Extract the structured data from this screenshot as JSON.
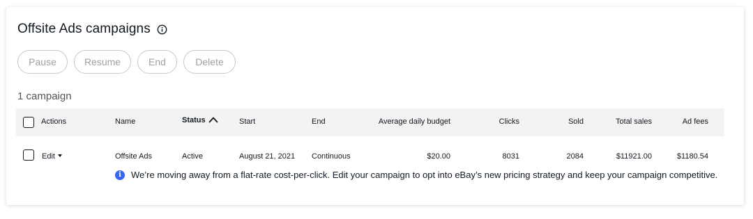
{
  "header": {
    "title": "Offsite Ads campaigns",
    "info_icon": "info-circle-icon"
  },
  "actions": {
    "pause": "Pause",
    "resume": "Resume",
    "end": "End",
    "delete": "Delete"
  },
  "campaign_count": "1 campaign",
  "table": {
    "columns": {
      "actions": "Actions",
      "name": "Name",
      "status": "Status",
      "start": "Start",
      "end": "End",
      "budget": "Average daily budget",
      "clicks": "Clicks",
      "sold": "Sold",
      "total_sales": "Total sales",
      "ad_fees": "Ad fees"
    },
    "sort": {
      "column": "status",
      "direction": "ascending",
      "icon": "chevron-up-icon"
    },
    "rows": [
      {
        "action": "Edit",
        "name": "Offsite Ads",
        "status": "Active",
        "start": "August 21, 2021",
        "end": "Continuous",
        "budget": "$20.00",
        "clicks": "8031",
        "sold": "2084",
        "total_sales": "$11921.00",
        "ad_fees": "$1180.54"
      }
    ]
  },
  "notice": {
    "icon": "info-filled-icon",
    "text": "We’re moving away from a flat-rate cost-per-click. Edit your campaign to opt into eBay’s new pricing strategy and keep your campaign competitive."
  },
  "colors": {
    "text": "#111820",
    "disabled": "#a0a0a0",
    "header_bg": "#f3f3f3",
    "accent": "#3665f3"
  }
}
